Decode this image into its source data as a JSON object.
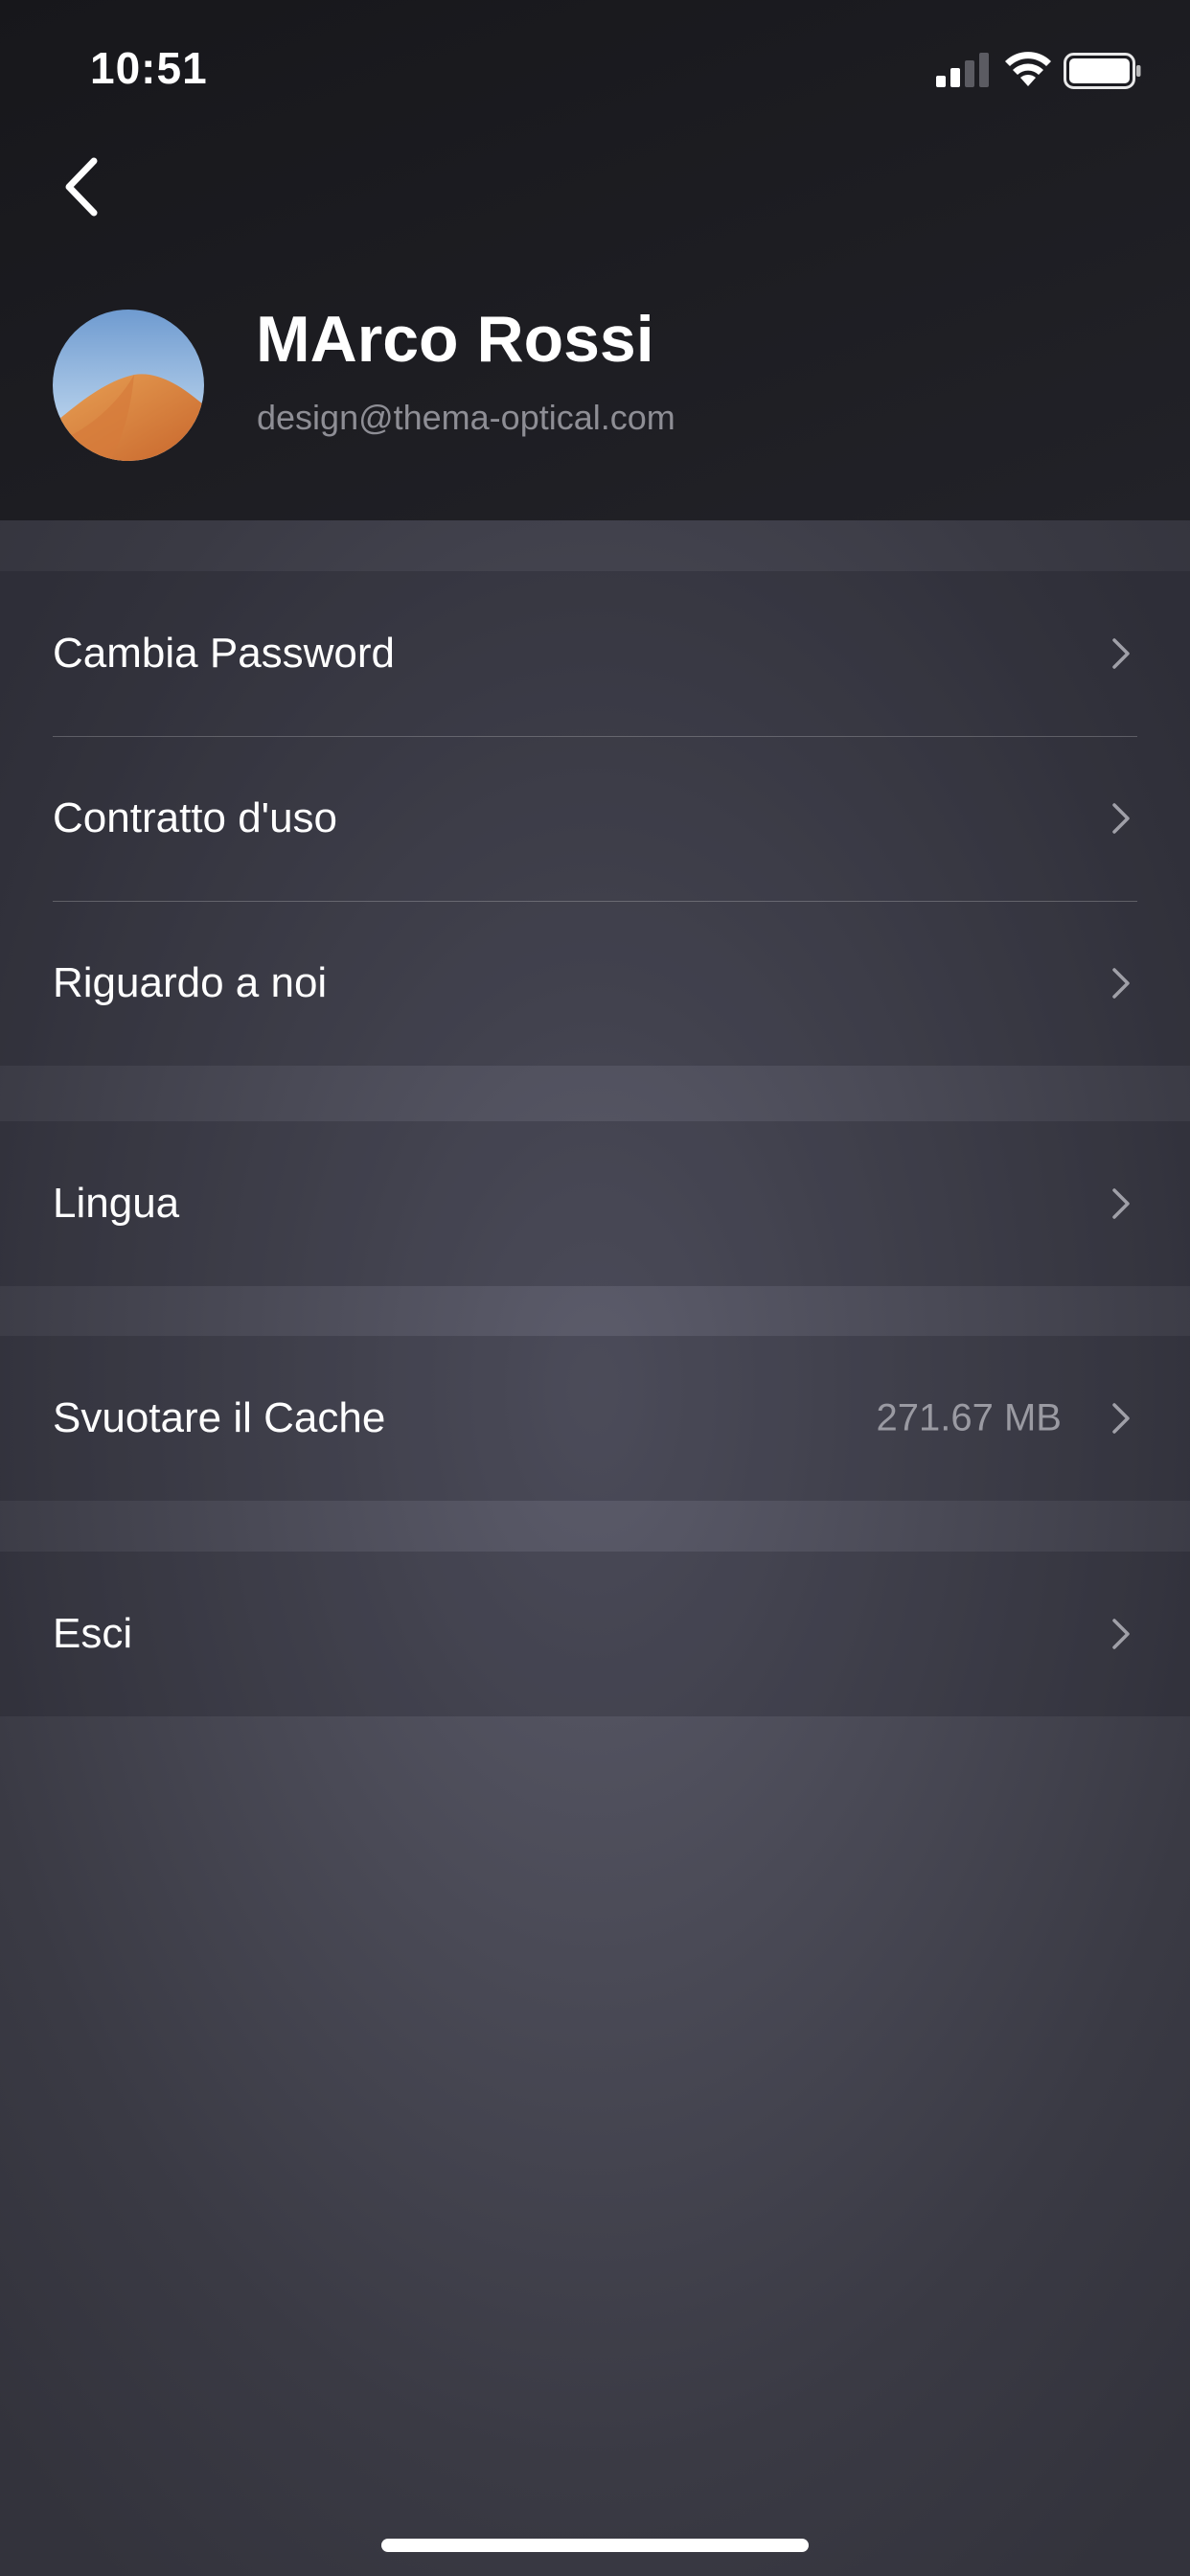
{
  "status_bar": {
    "time": "10:51",
    "signal_icon": "cellular-signal-icon",
    "wifi_icon": "wifi-icon",
    "battery_icon": "battery-icon"
  },
  "nav": {
    "back_icon": "chevron-left-icon"
  },
  "profile": {
    "name": "MArco Rossi",
    "email": "design@thema-optical.com",
    "avatar_icon": "avatar-desert-dune"
  },
  "settings": {
    "group1": [
      {
        "label": "Cambia Password"
      },
      {
        "label": "Contratto d'uso"
      },
      {
        "label": "Riguardo a noi"
      }
    ],
    "group2": [
      {
        "label": "Lingua"
      }
    ],
    "group3": [
      {
        "label": "Svuotare il Cache",
        "value": "271.67 MB"
      }
    ],
    "group4": [
      {
        "label": "Esci"
      }
    ]
  },
  "colors": {
    "header_bg": "#1b1b20",
    "page_bg": "#4a4a56",
    "text_primary": "#ffffff",
    "text_secondary": "#8e8e95"
  }
}
